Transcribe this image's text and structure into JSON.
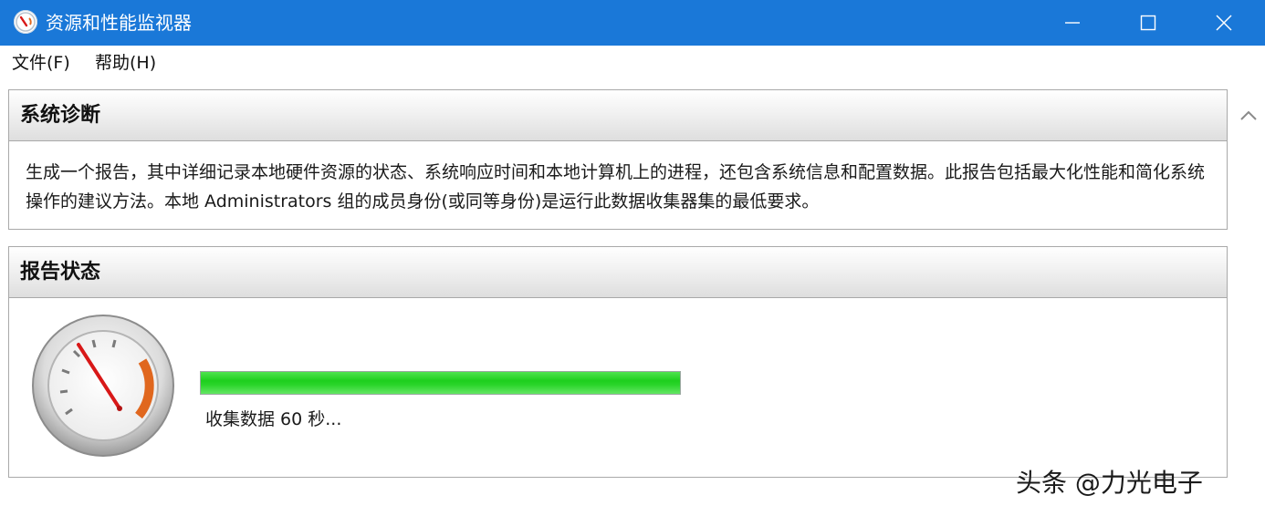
{
  "window": {
    "title": "资源和性能监视器",
    "icon": "performance-monitor-icon",
    "controls": [
      "minimize-icon",
      "maximize-icon",
      "close-icon"
    ]
  },
  "menu": {
    "file": "文件(F)",
    "help": "帮助(H)"
  },
  "diagnosis": {
    "title": "系统诊断",
    "description": "生成一个报告，其中详细记录本地硬件资源的状态、系统响应时间和本地计算机上的进程，还包含系统信息和配置数据。此报告包括最大化性能和简化系统操作的建议方法。本地 Administrators 组的成员身份(或同等身份)是运行此数据收集器集的最低要求。"
  },
  "report_status": {
    "title": "报告状态",
    "progress": 1.0,
    "status_text": "收集数据 60 秒..."
  },
  "watermark": "头条 @力光电子",
  "colors": {
    "titlebar": "#1a78d8",
    "progress": "#2bd52b",
    "gauge_needle": "#d81818",
    "gauge_zone": "#e0671e"
  }
}
